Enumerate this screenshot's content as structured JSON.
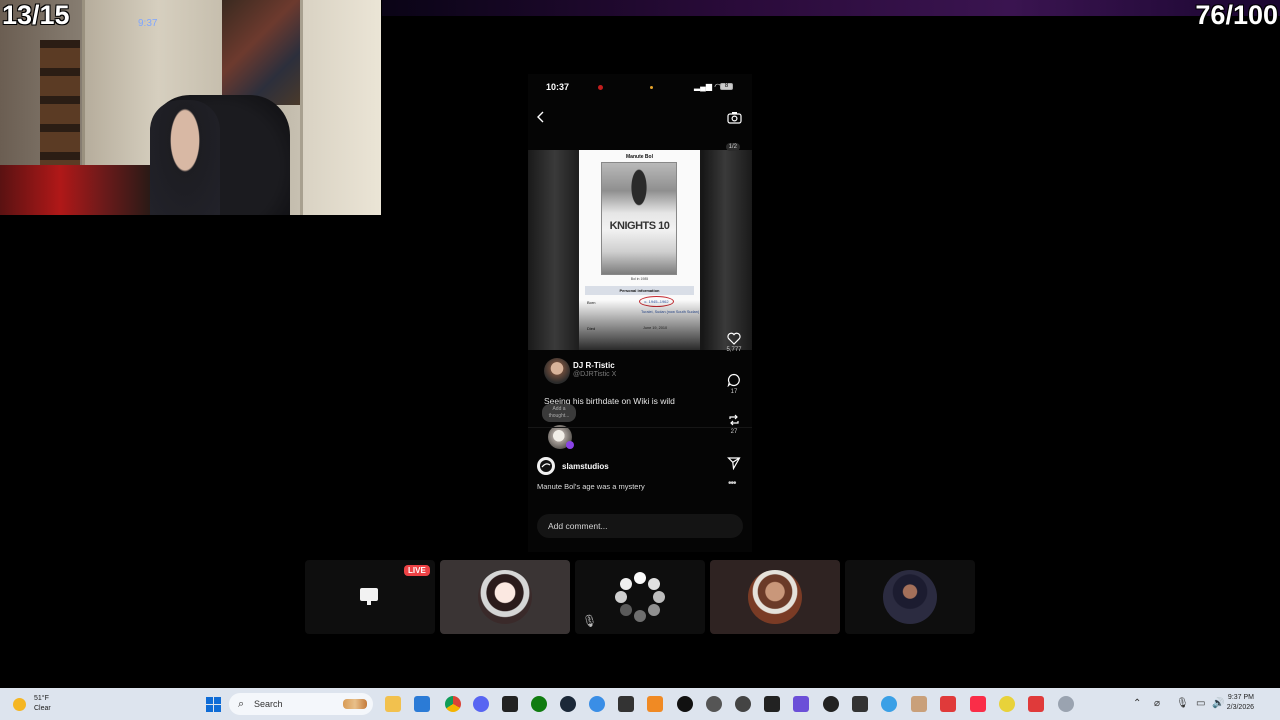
{
  "overlay": {
    "counter_left": "13/15",
    "counter_right": "76/100",
    "webcam_clock": "9:37"
  },
  "phone": {
    "status_time": "10:37",
    "battery": "8",
    "page_indicator": "1/2",
    "card": {
      "title": "Manute Bol",
      "jersey": "KNIGHTS 10",
      "photo_caption": "Bol in 1985",
      "info_header": "Personal information",
      "born_label": "Born",
      "born_value": "c. 1945–1962",
      "born_place": "Turalei, Sudan (now South Sudan)",
      "died_label": "Died",
      "died_value": "June 19, 2010"
    },
    "author_name": "DJ R-Tistic",
    "author_handle": "@DJRTistic X",
    "post_text": "Seeing his birthdate on Wiki is wild",
    "thought_bubble": "Add a thought...",
    "likes": "5,777",
    "comments": "17",
    "reposts": "27",
    "account_name": "slamstudios",
    "account_caption": "Manute Bol's age was a mystery",
    "more": "•••",
    "comment_placeholder": "Add comment..."
  },
  "discord": {
    "live_badge": "LIVE",
    "tiles": [
      "screen-share",
      "anime-avatar",
      "loading-avatar",
      "man-avatar",
      "arms-up-avatar"
    ]
  },
  "taskbar": {
    "temperature": "51°F",
    "condition": "Clear",
    "search_label": "Search",
    "time": "9:37 PM",
    "date": "2/3/2026"
  }
}
